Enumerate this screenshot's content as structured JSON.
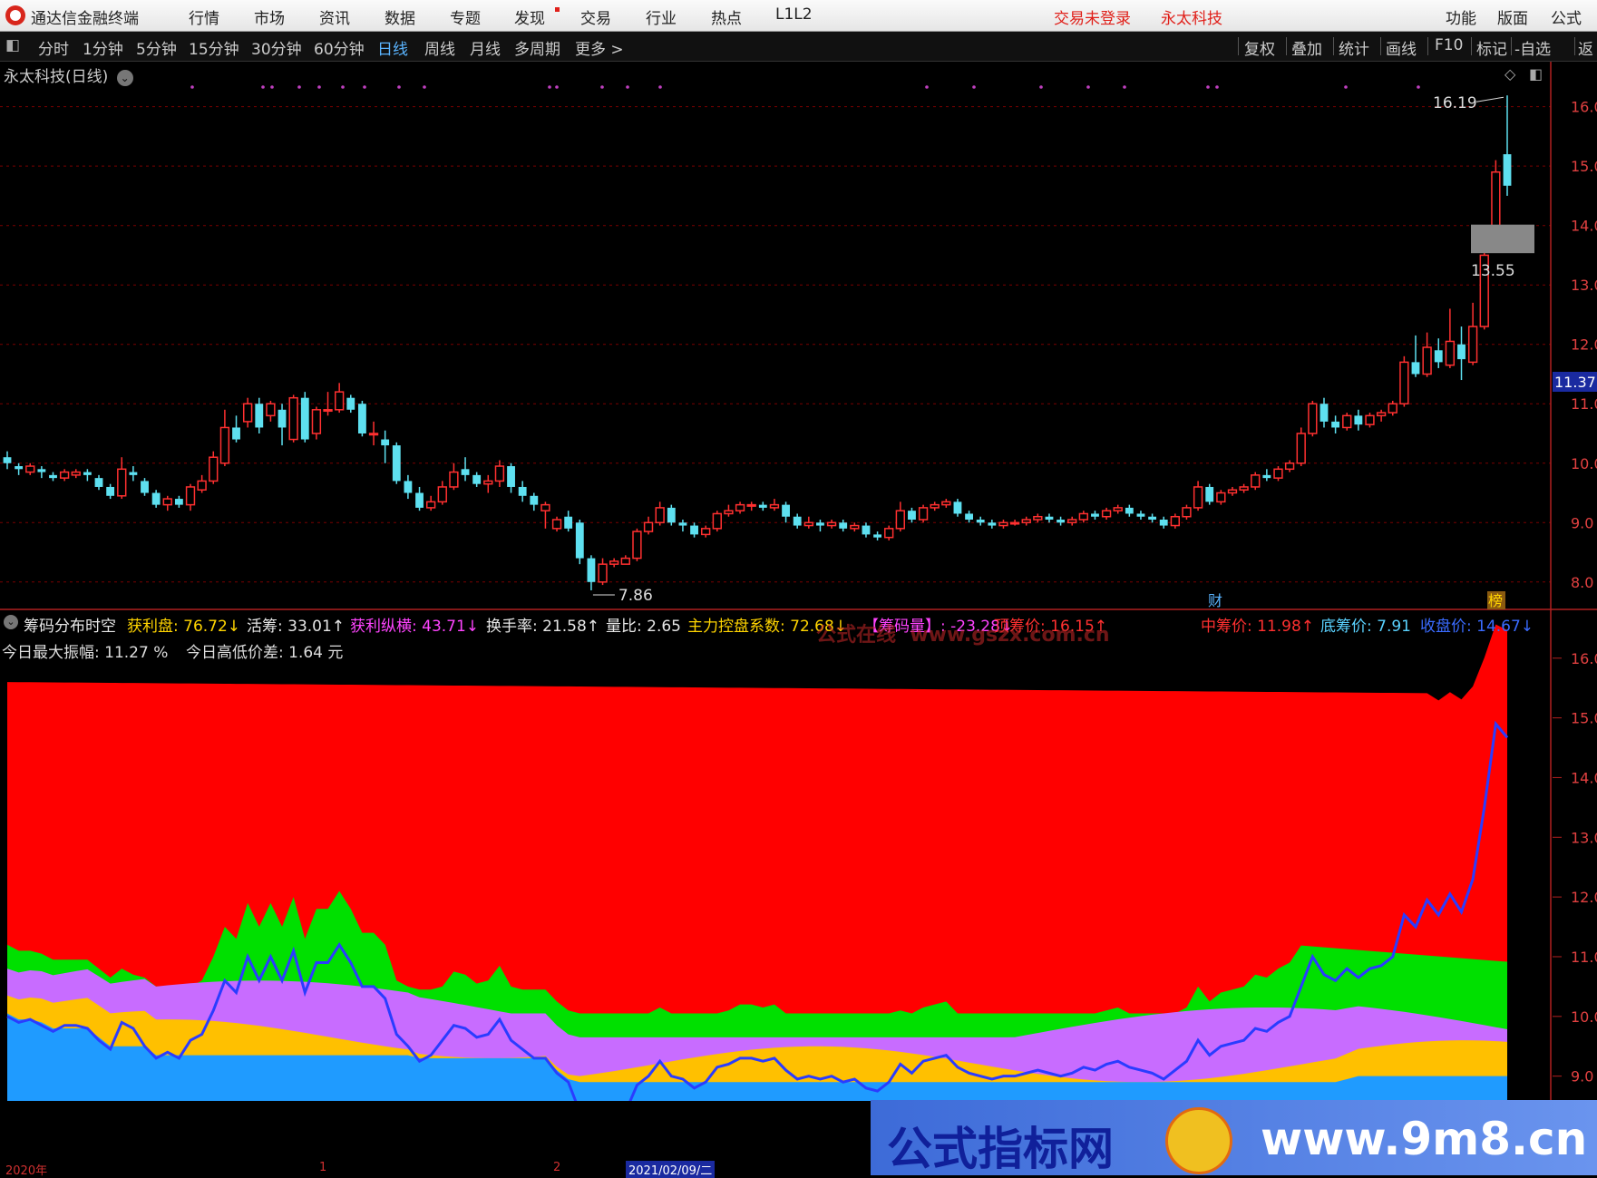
{
  "menubar": {
    "app_title": "通达信金融终端",
    "items": [
      "行情",
      "市场",
      "资讯",
      "数据",
      "专题",
      "发现",
      "交易",
      "行业",
      "热点",
      "L1L2"
    ],
    "login_status": "交易未登录",
    "stock_name": "永太科技",
    "right_items": [
      "功能",
      "版面",
      "公式"
    ]
  },
  "toolbar": {
    "periods": [
      "分时",
      "1分钟",
      "5分钟",
      "15分钟",
      "30分钟",
      "60分钟",
      "日线",
      "周线",
      "月线",
      "多周期",
      "更多 >"
    ],
    "active_period": "日线",
    "right_buttons": [
      "复权",
      "叠加",
      "统计",
      "画线",
      "F10",
      "标记",
      "-自选",
      "返"
    ]
  },
  "chart_title": "永太科技(日线)",
  "price_axis_labels": [
    "16.0",
    "15.0",
    "14.0",
    "13.0",
    "12.0",
    "11.0",
    "10.0",
    "9.0",
    "8.0"
  ],
  "lower_axis_labels": [
    "16.0",
    "15.0",
    "14.0",
    "13.0",
    "12.0",
    "11.0",
    "10.0",
    "9.0"
  ],
  "current_price_tag": "11.37",
  "annotations": {
    "high": "16.19",
    "low": "7.86",
    "level": "13.55",
    "markers": [
      "财",
      "榜"
    ]
  },
  "indicator_title": "筹码分布时空",
  "indicators": [
    {
      "label": "获利盘",
      "value": "76.72",
      "arrow": "↓",
      "color": "#ffd400"
    },
    {
      "label": "活筹",
      "value": "33.01",
      "arrow": "↑",
      "color": "#e6e6e6"
    },
    {
      "label": "获利纵横",
      "value": "43.71",
      "arrow": "↓",
      "color": "#ff44ff"
    },
    {
      "label": "换手率",
      "value": "21.58",
      "arrow": "↑",
      "color": "#e6e6e6"
    },
    {
      "label": "量比",
      "value": "2.65",
      "arrow": "",
      "color": "#e6e6e6"
    },
    {
      "label": "主力控盘系数",
      "value": "72.68",
      "arrow": "↓",
      "color": "#ffd400"
    },
    {
      "label": "【筹码量】",
      "value": "-23.28",
      "arrow": "↓",
      "color": "#ff44ff"
    },
    {
      "label": "顶筹价",
      "value": "16.15",
      "arrow": "↑",
      "color": "#ff3030"
    },
    {
      "label": "中筹价",
      "value": "11.98",
      "arrow": "↑",
      "color": "#ff3030"
    },
    {
      "label": "底筹价",
      "value": "7.91",
      "arrow": "",
      "color": "#5ad2ff"
    },
    {
      "label": "收盘价",
      "value": "14.67",
      "arrow": "↓",
      "color": "#3a6bff"
    }
  ],
  "indicator_line2": {
    "amp_label": "今日最大振幅",
    "amp_value": "11.27 %",
    "diff_label": "今日高低价差",
    "diff_value": "1.64 元"
  },
  "watermark_faint": "公式在线  www.gszx.com.cn",
  "watermark": {
    "cn": "公式指标网",
    "url": "www.9m8.cn"
  },
  "time_axis": [
    "2020年",
    "1",
    "2",
    "2021/02/09/二"
  ],
  "colors": {
    "up": "#ff3030",
    "down": "#5ee0f0",
    "bg": "#000000",
    "grid": "#7a0000"
  },
  "chart_data": {
    "type": "candlestick",
    "y_range": [
      7.6,
      16.3
    ],
    "candles": [
      [
        10.1,
        10.0,
        10.2,
        9.9
      ],
      [
        9.95,
        9.9,
        10.0,
        9.8
      ],
      [
        9.85,
        9.95,
        10.0,
        9.8
      ],
      [
        9.9,
        9.85,
        9.95,
        9.75
      ],
      [
        9.8,
        9.75,
        9.85,
        9.7
      ],
      [
        9.75,
        9.85,
        9.9,
        9.7
      ],
      [
        9.8,
        9.85,
        9.9,
        9.75
      ],
      [
        9.85,
        9.8,
        9.9,
        9.7
      ],
      [
        9.75,
        9.6,
        9.8,
        9.55
      ],
      [
        9.6,
        9.45,
        9.65,
        9.4
      ],
      [
        9.45,
        9.9,
        10.1,
        9.4
      ],
      [
        9.85,
        9.8,
        9.95,
        9.7
      ],
      [
        9.7,
        9.5,
        9.75,
        9.45
      ],
      [
        9.5,
        9.3,
        9.55,
        9.25
      ],
      [
        9.3,
        9.4,
        9.45,
        9.2
      ],
      [
        9.4,
        9.3,
        9.45,
        9.25
      ],
      [
        9.3,
        9.6,
        9.65,
        9.2
      ],
      [
        9.55,
        9.7,
        9.8,
        9.5
      ],
      [
        9.7,
        10.1,
        10.2,
        9.65
      ],
      [
        10.0,
        10.6,
        10.9,
        9.95
      ],
      [
        10.6,
        10.4,
        10.8,
        10.35
      ],
      [
        10.7,
        11.0,
        11.1,
        10.6
      ],
      [
        11.0,
        10.6,
        11.1,
        10.5
      ],
      [
        10.8,
        11.0,
        11.05,
        10.7
      ],
      [
        10.9,
        10.6,
        11.0,
        10.3
      ],
      [
        10.4,
        11.1,
        11.15,
        10.35
      ],
      [
        11.1,
        10.4,
        11.2,
        10.35
      ],
      [
        10.5,
        10.9,
        10.95,
        10.4
      ],
      [
        10.9,
        10.9,
        11.2,
        10.8
      ],
      [
        10.9,
        11.2,
        11.35,
        10.85
      ],
      [
        11.1,
        10.9,
        11.15,
        10.85
      ],
      [
        11.0,
        10.5,
        11.05,
        10.45
      ],
      [
        10.5,
        10.5,
        10.7,
        10.3
      ],
      [
        10.4,
        10.3,
        10.55,
        10.0
      ],
      [
        10.3,
        9.7,
        10.35,
        9.65
      ],
      [
        9.7,
        9.5,
        9.8,
        9.4
      ],
      [
        9.5,
        9.25,
        9.6,
        9.2
      ],
      [
        9.25,
        9.35,
        9.45,
        9.2
      ],
      [
        9.35,
        9.6,
        9.7,
        9.3
      ],
      [
        9.6,
        9.85,
        10.0,
        9.55
      ],
      [
        9.9,
        9.8,
        10.1,
        9.7
      ],
      [
        9.8,
        9.65,
        9.85,
        9.6
      ],
      [
        9.65,
        9.7,
        9.8,
        9.5
      ],
      [
        9.7,
        9.95,
        10.05,
        9.6
      ],
      [
        9.95,
        9.6,
        10.0,
        9.5
      ],
      [
        9.6,
        9.45,
        9.7,
        9.35
      ],
      [
        9.45,
        9.3,
        9.5,
        9.2
      ],
      [
        9.2,
        9.3,
        9.35,
        8.9
      ],
      [
        8.9,
        9.05,
        9.1,
        8.85
      ],
      [
        9.1,
        8.9,
        9.2,
        8.85
      ],
      [
        9.0,
        8.4,
        9.05,
        8.3
      ],
      [
        8.4,
        8.0,
        8.45,
        7.86
      ],
      [
        8.0,
        8.3,
        8.4,
        7.95
      ],
      [
        8.3,
        8.35,
        8.4,
        8.25
      ],
      [
        8.3,
        8.4,
        8.45,
        8.3
      ],
      [
        8.4,
        8.85,
        8.9,
        8.35
      ],
      [
        8.85,
        9.0,
        9.1,
        8.8
      ],
      [
        9.0,
        9.25,
        9.35,
        8.95
      ],
      [
        9.25,
        9.0,
        9.3,
        8.95
      ],
      [
        9.0,
        8.95,
        9.05,
        8.85
      ],
      [
        8.95,
        8.8,
        9.0,
        8.75
      ],
      [
        8.8,
        8.9,
        8.95,
        8.75
      ],
      [
        8.9,
        9.15,
        9.2,
        8.85
      ],
      [
        9.15,
        9.2,
        9.3,
        9.1
      ],
      [
        9.2,
        9.3,
        9.35,
        9.15
      ],
      [
        9.3,
        9.3,
        9.35,
        9.2
      ],
      [
        9.3,
        9.25,
        9.35,
        9.2
      ],
      [
        9.25,
        9.3,
        9.4,
        9.2
      ],
      [
        9.3,
        9.1,
        9.35,
        9.0
      ],
      [
        9.1,
        8.95,
        9.15,
        8.9
      ],
      [
        8.95,
        9.0,
        9.1,
        8.9
      ],
      [
        9.0,
        8.95,
        9.05,
        8.85
      ],
      [
        8.95,
        9.0,
        9.05,
        8.9
      ],
      [
        9.0,
        8.9,
        9.05,
        8.85
      ],
      [
        8.9,
        8.95,
        9.0,
        8.85
      ],
      [
        8.95,
        8.8,
        9.0,
        8.75
      ],
      [
        8.8,
        8.75,
        8.85,
        8.7
      ],
      [
        8.75,
        8.9,
        8.95,
        8.7
      ],
      [
        8.9,
        9.2,
        9.35,
        8.85
      ],
      [
        9.2,
        9.05,
        9.25,
        9.0
      ],
      [
        9.05,
        9.25,
        9.3,
        9.0
      ],
      [
        9.25,
        9.3,
        9.35,
        9.2
      ],
      [
        9.3,
        9.35,
        9.4,
        9.25
      ],
      [
        9.35,
        9.15,
        9.4,
        9.1
      ],
      [
        9.15,
        9.05,
        9.2,
        9.0
      ],
      [
        9.05,
        9.0,
        9.1,
        8.95
      ],
      [
        9.0,
        8.95,
        9.05,
        8.9
      ],
      [
        8.95,
        9.0,
        9.05,
        8.9
      ],
      [
        9.0,
        9.0,
        9.05,
        8.95
      ],
      [
        9.0,
        9.05,
        9.1,
        8.95
      ],
      [
        9.05,
        9.1,
        9.15,
        9.0
      ],
      [
        9.1,
        9.05,
        9.15,
        9.0
      ],
      [
        9.05,
        9.0,
        9.1,
        8.95
      ],
      [
        9.0,
        9.05,
        9.1,
        8.95
      ],
      [
        9.05,
        9.15,
        9.2,
        9.0
      ],
      [
        9.15,
        9.1,
        9.2,
        9.05
      ],
      [
        9.1,
        9.2,
        9.25,
        9.05
      ],
      [
        9.2,
        9.25,
        9.3,
        9.15
      ],
      [
        9.25,
        9.15,
        9.3,
        9.1
      ],
      [
        9.15,
        9.1,
        9.2,
        9.05
      ],
      [
        9.1,
        9.05,
        9.15,
        9.0
      ],
      [
        9.05,
        8.95,
        9.1,
        8.9
      ],
      [
        8.95,
        9.1,
        9.15,
        8.9
      ],
      [
        9.1,
        9.25,
        9.3,
        9.05
      ],
      [
        9.25,
        9.6,
        9.7,
        9.2
      ],
      [
        9.6,
        9.35,
        9.65,
        9.3
      ],
      [
        9.35,
        9.5,
        9.55,
        9.3
      ],
      [
        9.5,
        9.55,
        9.6,
        9.45
      ],
      [
        9.55,
        9.6,
        9.65,
        9.5
      ],
      [
        9.6,
        9.8,
        9.85,
        9.55
      ],
      [
        9.8,
        9.75,
        9.9,
        9.7
      ],
      [
        9.75,
        9.9,
        9.95,
        9.7
      ],
      [
        9.9,
        10.0,
        10.05,
        9.85
      ],
      [
        10.0,
        10.5,
        10.6,
        9.95
      ],
      [
        10.5,
        11.0,
        11.05,
        10.45
      ],
      [
        11.0,
        10.7,
        11.1,
        10.6
      ],
      [
        10.7,
        10.6,
        10.8,
        10.5
      ],
      [
        10.6,
        10.8,
        10.85,
        10.55
      ],
      [
        10.8,
        10.65,
        10.9,
        10.55
      ],
      [
        10.65,
        10.8,
        10.85,
        10.6
      ],
      [
        10.8,
        10.85,
        10.9,
        10.7
      ],
      [
        10.85,
        11.0,
        11.05,
        10.8
      ],
      [
        11.0,
        11.7,
        11.8,
        10.95
      ],
      [
        11.7,
        11.5,
        12.15,
        11.45
      ],
      [
        11.5,
        11.95,
        12.2,
        11.45
      ],
      [
        11.9,
        11.7,
        12.1,
        11.6
      ],
      [
        11.65,
        12.05,
        12.6,
        11.6
      ],
      [
        12.0,
        11.75,
        12.3,
        11.4
      ],
      [
        11.7,
        12.3,
        12.7,
        11.65
      ],
      [
        12.3,
        13.5,
        13.55,
        12.25
      ],
      [
        13.6,
        14.9,
        15.1,
        13.6
      ],
      [
        15.2,
        14.67,
        16.19,
        14.5
      ]
    ]
  }
}
